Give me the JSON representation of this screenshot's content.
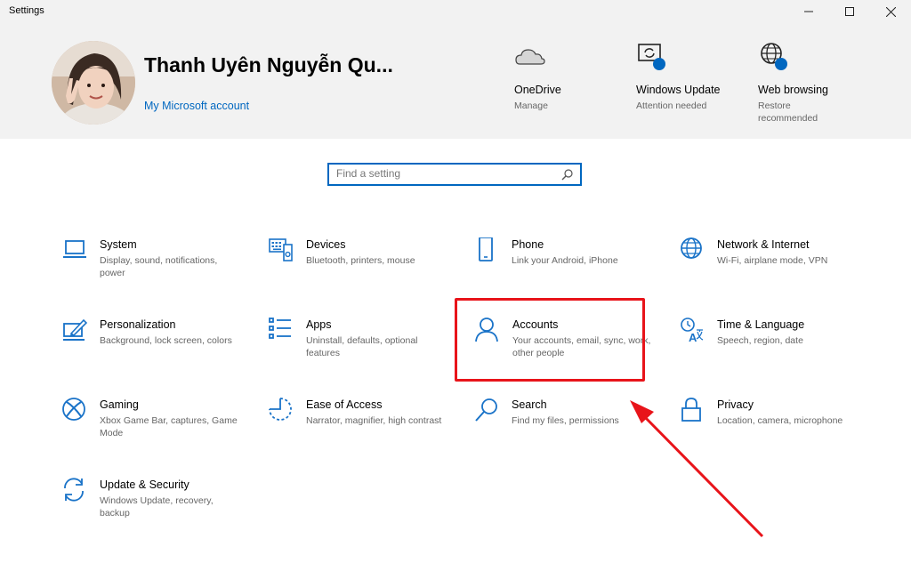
{
  "window": {
    "title": "Settings"
  },
  "header": {
    "user_name": "Thanh Uyên Nguyễn Qu...",
    "account_link": "My Microsoft account",
    "items": [
      {
        "title": "OneDrive",
        "subtitle": "Manage",
        "icon": "cloud-icon"
      },
      {
        "title": "Windows Update",
        "subtitle": "Attention needed",
        "icon": "windows-update-icon"
      },
      {
        "title": "Web browsing",
        "subtitle": "Restore recommended",
        "icon": "globe-icon"
      }
    ]
  },
  "search": {
    "placeholder": "Find a setting"
  },
  "categories": [
    {
      "title": "System",
      "subtitle": "Display, sound, notifications, power",
      "icon": "laptop-icon"
    },
    {
      "title": "Devices",
      "subtitle": "Bluetooth, printers, mouse",
      "icon": "keyboard-icon"
    },
    {
      "title": "Phone",
      "subtitle": "Link your Android, iPhone",
      "icon": "phone-icon"
    },
    {
      "title": "Network & Internet",
      "subtitle": "Wi-Fi, airplane mode, VPN",
      "icon": "globe-icon"
    },
    {
      "title": "Personalization",
      "subtitle": "Background, lock screen, colors",
      "icon": "paint-icon"
    },
    {
      "title": "Apps",
      "subtitle": "Uninstall, defaults, optional features",
      "icon": "apps-list-icon"
    },
    {
      "title": "Accounts",
      "subtitle": "Your accounts, email, sync, work, other people",
      "icon": "person-icon"
    },
    {
      "title": "Time & Language",
      "subtitle": "Speech, region, date",
      "icon": "time-language-icon"
    },
    {
      "title": "Gaming",
      "subtitle": "Xbox Game Bar, captures, Game Mode",
      "icon": "xbox-icon"
    },
    {
      "title": "Ease of Access",
      "subtitle": "Narrator, magnifier, high contrast",
      "icon": "ease-of-access-icon"
    },
    {
      "title": "Search",
      "subtitle": "Find my files, permissions",
      "icon": "search-icon"
    },
    {
      "title": "Privacy",
      "subtitle": "Location, camera, microphone",
      "icon": "lock-icon"
    },
    {
      "title": "Update & Security",
      "subtitle": "Windows Update, recovery, backup",
      "icon": "sync-icon"
    }
  ],
  "colors": {
    "accent": "#0067c0",
    "icon": "#1a73c8",
    "highlight": "#e8141a",
    "header_bg": "#f2f2f2"
  }
}
